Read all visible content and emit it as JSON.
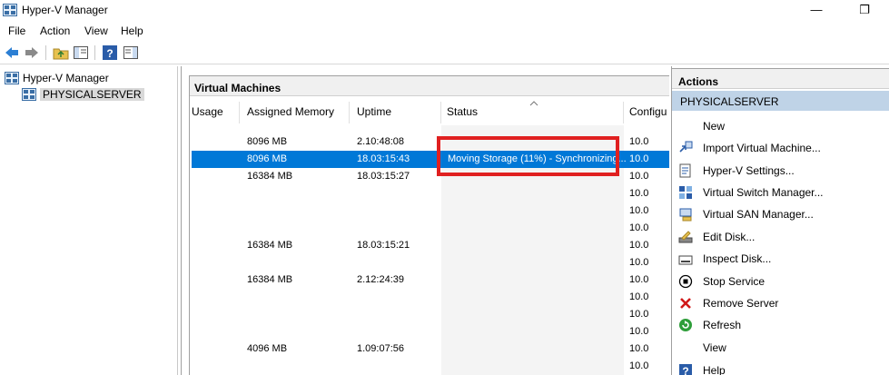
{
  "window": {
    "title": "Hyper-V Manager",
    "minimize_glyph": "—",
    "restore_glyph": "❐"
  },
  "menu": {
    "items": [
      "File",
      "Action",
      "View",
      "Help"
    ]
  },
  "toolbar": {
    "icons": [
      "back-arrow-icon",
      "forward-arrow-icon",
      "up-folder-icon",
      "show-hide-tree-icon",
      "help-icon",
      "show-hide-action-pane-icon"
    ]
  },
  "tree": {
    "root_label": "Hyper-V Manager",
    "server_label": "PHYSICALSERVER"
  },
  "vm_panel": {
    "title": "Virtual Machines",
    "columns": [
      "Usage",
      "Assigned Memory",
      "Uptime",
      "Status",
      "Configu"
    ],
    "rows": [
      {
        "memory": "8096 MB",
        "uptime": "2.10:48:08",
        "status": "",
        "config": "10.0"
      },
      {
        "memory": "8096 MB",
        "uptime": "18.03:15:43",
        "status": "Moving Storage (11%) - Synchronizing...",
        "config": "10.0"
      },
      {
        "memory": "16384 MB",
        "uptime": "18.03:15:27",
        "status": "",
        "config": "10.0"
      },
      {
        "memory": "",
        "uptime": "",
        "status": "",
        "config": "10.0"
      },
      {
        "memory": "",
        "uptime": "",
        "status": "",
        "config": "10.0"
      },
      {
        "memory": "",
        "uptime": "",
        "status": "",
        "config": "10.0"
      },
      {
        "memory": "16384 MB",
        "uptime": "18.03:15:21",
        "status": "",
        "config": "10.0"
      },
      {
        "memory": "",
        "uptime": "",
        "status": "",
        "config": "10.0"
      },
      {
        "memory": "16384 MB",
        "uptime": "2.12:24:39",
        "status": "",
        "config": "10.0"
      },
      {
        "memory": "",
        "uptime": "",
        "status": "",
        "config": "10.0"
      },
      {
        "memory": "",
        "uptime": "",
        "status": "",
        "config": "10.0"
      },
      {
        "memory": "",
        "uptime": "",
        "status": "",
        "config": "10.0"
      },
      {
        "memory": "4096 MB",
        "uptime": "1.09:07:56",
        "status": "",
        "config": "10.0"
      },
      {
        "memory": "",
        "uptime": "",
        "status": "",
        "config": "10.0"
      }
    ],
    "selected_row": 1
  },
  "actions": {
    "header": "Actions",
    "section": "PHYSICALSERVER",
    "items": [
      {
        "label": "New",
        "icon": "none"
      },
      {
        "label": "Import Virtual Machine...",
        "icon": "import-vm-icon"
      },
      {
        "label": "Hyper-V Settings...",
        "icon": "settings-icon"
      },
      {
        "label": "Virtual Switch Manager...",
        "icon": "virtual-switch-icon"
      },
      {
        "label": "Virtual SAN Manager...",
        "icon": "virtual-san-icon"
      },
      {
        "label": "Edit Disk...",
        "icon": "edit-disk-icon"
      },
      {
        "label": "Inspect Disk...",
        "icon": "inspect-disk-icon"
      },
      {
        "label": "Stop Service",
        "icon": "stop-icon"
      },
      {
        "label": "Remove Server",
        "icon": "remove-x-icon"
      },
      {
        "label": "Refresh",
        "icon": "refresh-icon"
      },
      {
        "label": "View",
        "icon": "none"
      },
      {
        "label": "Help",
        "icon": "help-icon"
      }
    ]
  },
  "colors": {
    "selection": "#0078d7",
    "action_section": "#bfd3e7",
    "highlight_box": "#e02020"
  }
}
